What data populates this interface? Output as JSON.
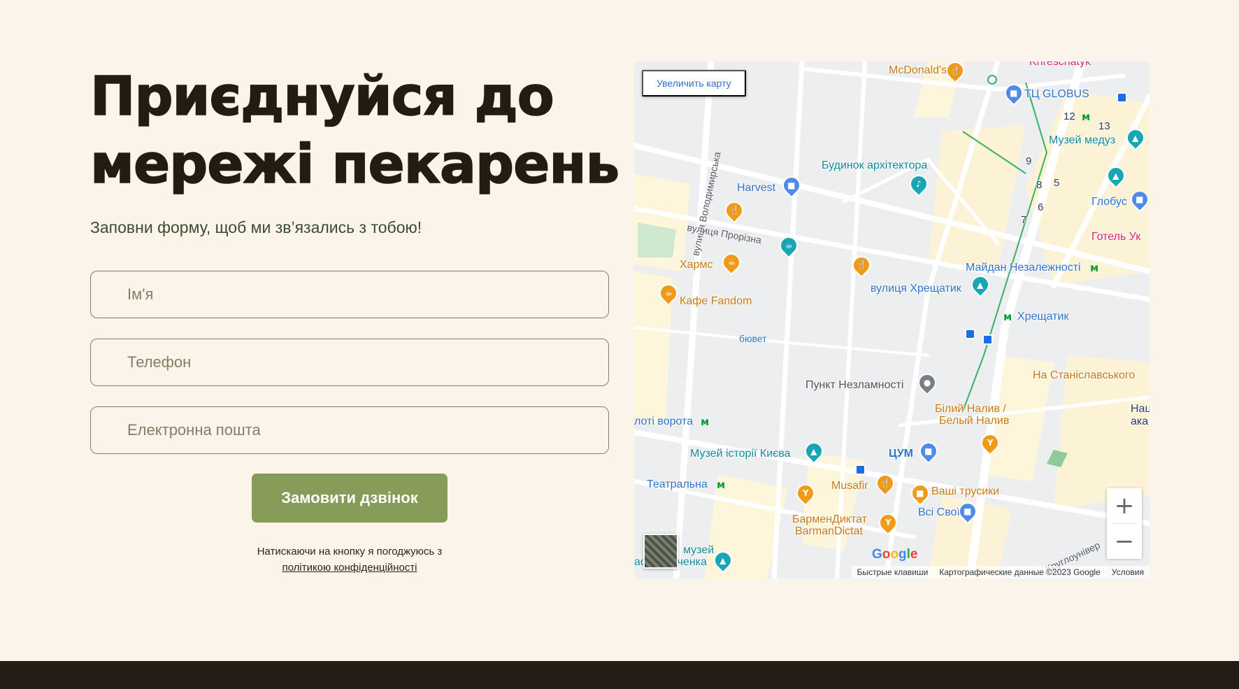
{
  "headline": {
    "line1": "Приєднуйся до",
    "line2": "мережі пекарень"
  },
  "subtitle": "Заповни форму, щоб ми зв’язались з тобою!",
  "form": {
    "name_placeholder": "Ім'я",
    "phone_placeholder": "Телефон",
    "email_placeholder": "Електронна пошта",
    "submit_label": "Замовити дзвінок",
    "consent_text": "Натискаючи на кнопку я погоджуюсь з",
    "policy_link": "політикою конфіденційності"
  },
  "map": {
    "enlarge_label": "Увеличить карту",
    "labels": {
      "mcdonalds": "McDonald's",
      "globus_tc": "ТЦ GLOBUS",
      "muzei_medusa": "Музей медуз",
      "budynok": "Будинок архітектора",
      "harvest": "Harvest",
      "globus": "Глобус",
      "hotel": "Готель Ук",
      "maidan": "Майдан Незалежності",
      "khreshchatyk_st": "вулиця Хрещатик",
      "khreshchatyk": "Хрещатик",
      "kharms": "Хармс",
      "fandom": "Кафе Fandom",
      "buvet": "бювет",
      "punkt": "Пункт Незламності",
      "stanislavsky": "На Станіславського",
      "bilyi_naliv_1": "Білий Налив /",
      "bilyi_naliv_2": "Белый Налив",
      "zoloti": "лоті ворота",
      "museum_kyiv": "Музей історії Києва",
      "tsum": "ЦУМ",
      "teatralna": "Театральна",
      "musafir": "Musafir",
      "vashi": "Ваші трусики",
      "vsi_svoi": "Всі Свої",
      "barmen_1": "БарменДиктат",
      "barmen_2": "BarmanDictat",
      "muzei_1": "музей",
      "muzei_2": "аса Шевченка",
      "khreschatyk_top": "Khreschatyk",
      "nas_1": "Нац",
      "nas_2": "ака"
    },
    "streets": {
      "volodymyrska": "вулиця Володимирська",
      "prorizna": "вулиця Прорізна",
      "kruhlouniver": "Круглоунівер"
    },
    "numbers": [
      "12",
      "13",
      "9",
      "8",
      "5",
      "6",
      "7"
    ],
    "attribution": {
      "shortcuts": "Быстрые клавиши",
      "data": "Картографические данные ©2023 Google",
      "terms": "Условия"
    },
    "google_logo": "Google"
  }
}
